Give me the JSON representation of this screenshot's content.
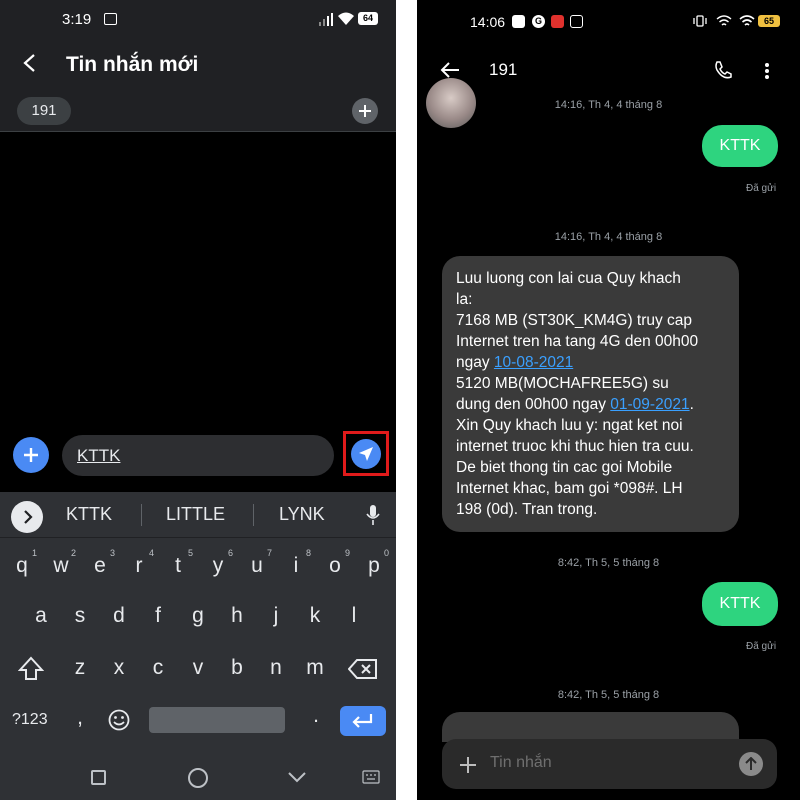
{
  "left": {
    "status": {
      "time": "3:19",
      "battery": "64"
    },
    "header": {
      "title": "Tin nhắn mới"
    },
    "recipient_chip": "191",
    "compose": {
      "value": "KTTK"
    },
    "suggestions": [
      "KTTK",
      "LITTLE",
      "LYNK"
    ],
    "keys": {
      "row1": [
        "q",
        "w",
        "e",
        "r",
        "t",
        "y",
        "u",
        "i",
        "o",
        "p"
      ],
      "row1_hints": [
        "1",
        "2",
        "3",
        "4",
        "5",
        "6",
        "7",
        "8",
        "9",
        "0"
      ],
      "row2": [
        "a",
        "s",
        "d",
        "f",
        "g",
        "h",
        "j",
        "k",
        "l"
      ],
      "row3": [
        "z",
        "x",
        "c",
        "v",
        "b",
        "n",
        "m"
      ],
      "numbers_key": "?123",
      "comma_key": ",",
      "period_key": "."
    }
  },
  "right": {
    "status": {
      "time": "14:06",
      "battery": "65"
    },
    "header": {
      "title": "191"
    },
    "messages": {
      "ts1": "14:16, Th 4, 4 tháng 8",
      "sent1": "KTTK",
      "delivered1": "Đã gửi",
      "ts2": "14:16, Th 4, 4 tháng 8",
      "recv_l1": "Luu luong con lai cua Quy khach",
      "recv_l2": "la:",
      "recv_l3": "7168 MB (ST30K_KM4G) truy cap",
      "recv_l4": "Internet tren ha tang 4G den 00h00",
      "recv_l5a": "ngay ",
      "recv_l5_link": "10-08-2021",
      "recv_l6": "5120 MB(MOCHAFREE5G) su",
      "recv_l7a": "dung den 00h00 ngay ",
      "recv_l7_link": "01-09-2021",
      "recv_l7b": ".",
      "recv_l8": "Xin Quy khach luu y: ngat ket noi",
      "recv_l9": "internet truoc khi thuc hien tra cuu.",
      "recv_l10": "De biet thong tin cac goi Mobile",
      "recv_l11": "Internet khac, bam goi *098#. LH",
      "recv_l12": "198 (0d). Tran trong.",
      "ts3": "8:42, Th 5, 5 tháng 8",
      "sent2": "KTTK",
      "delivered2": "Đã gửi",
      "ts4": "8:42, Th 5, 5 tháng 8"
    },
    "composer": {
      "placeholder": "Tin nhắn"
    }
  },
  "colors": {
    "accent_blue": "#4a8af4",
    "sent_green": "#2ed47f",
    "highlight_red": "#e01b1b"
  }
}
